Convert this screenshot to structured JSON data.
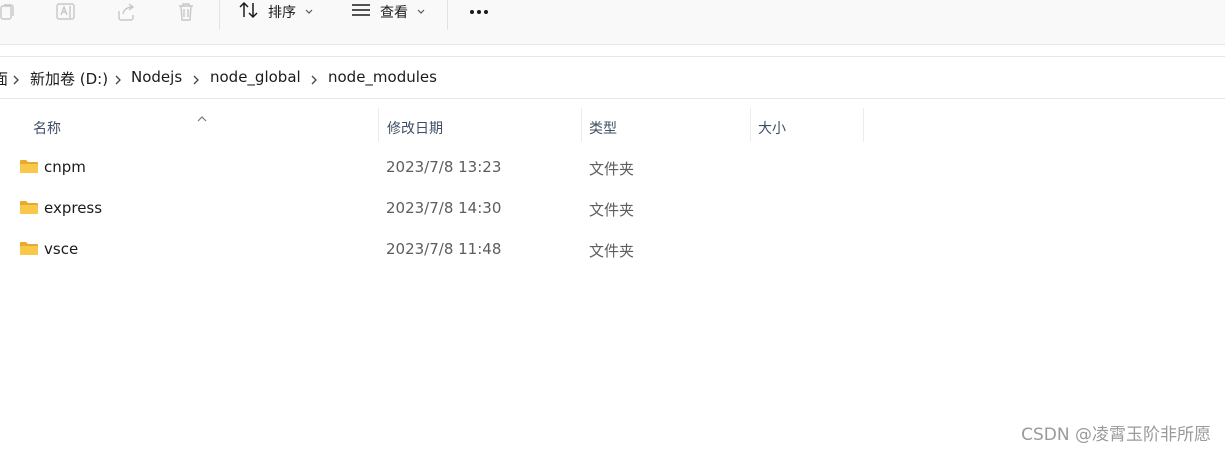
{
  "toolbar": {
    "icons": [
      "copy-icon",
      "rename-icon",
      "share-icon",
      "delete-icon"
    ],
    "sort_label": "排序",
    "view_label": "查看"
  },
  "breadcrumb": {
    "items": [
      "面",
      "新加卷 (D:)",
      "Nodejs",
      "node_global",
      "node_modules"
    ]
  },
  "columns": {
    "name": "名称",
    "modified": "修改日期",
    "type": "类型",
    "size": "大小"
  },
  "files": [
    {
      "name": "cnpm",
      "modified": "2023/7/8 13:23",
      "type": "文件夹",
      "size": ""
    },
    {
      "name": "express",
      "modified": "2023/7/8 14:30",
      "type": "文件夹",
      "size": ""
    },
    {
      "name": "vsce",
      "modified": "2023/7/8 11:48",
      "type": "文件夹",
      "size": ""
    }
  ],
  "watermark": "CSDN @凌霄玉阶非所愿",
  "colors": {
    "folder": "#f8c84a",
    "folder_dark": "#e9a92c",
    "muted_icon": "#c7c7c7"
  }
}
